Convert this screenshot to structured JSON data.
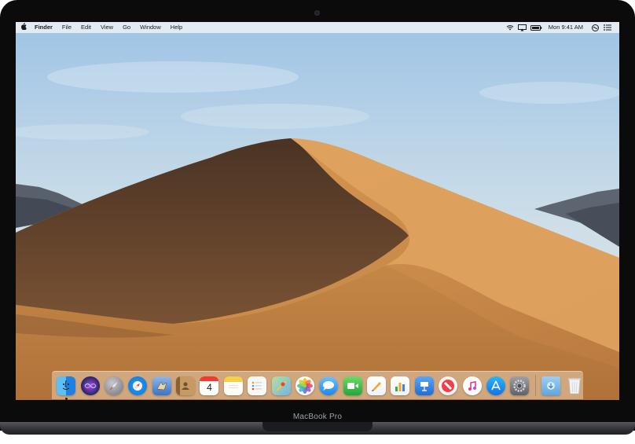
{
  "device": {
    "label": "MacBook Pro"
  },
  "menubar": {
    "apple_icon": "apple-logo",
    "app_name": "Finder",
    "menus": [
      "File",
      "Edit",
      "View",
      "Go",
      "Window",
      "Help"
    ],
    "clock": "Mon 9:41 AM",
    "status_icons": [
      "wifi-icon",
      "airplay-icon",
      "battery-icon",
      "siri-icon",
      "notification-center-icon"
    ]
  },
  "dock": {
    "apps": [
      {
        "name": "Finder",
        "color": "#2e9cf2",
        "running": true
      },
      {
        "name": "Siri",
        "color": "#3c2d78"
      },
      {
        "name": "Launchpad",
        "color": "#8c8f96"
      },
      {
        "name": "Safari",
        "color": "#1f8ff0"
      },
      {
        "name": "Mail",
        "color": "#5b8fd0"
      },
      {
        "name": "Contacts",
        "color": "#a2794a"
      },
      {
        "name": "Calendar",
        "color": "#ffffff",
        "badge_text": "4"
      },
      {
        "name": "Notes",
        "color": "#f7d55a"
      },
      {
        "name": "Reminders",
        "color": "#f4f4f4"
      },
      {
        "name": "Maps",
        "color": "#6fbf73"
      },
      {
        "name": "Photos",
        "color": "#ffffff"
      },
      {
        "name": "Messages",
        "color": "#3fa2f7"
      },
      {
        "name": "FaceTime",
        "color": "#3fc24c"
      },
      {
        "name": "Pages",
        "color": "#f5a623"
      },
      {
        "name": "Numbers",
        "color": "#2fb24a"
      },
      {
        "name": "Keynote",
        "color": "#2f7fe0"
      },
      {
        "name": "News",
        "color": "#f2f2f2"
      },
      {
        "name": "iTunes",
        "color": "#fdfdfd"
      },
      {
        "name": "App Store",
        "color": "#1f8ff0"
      },
      {
        "name": "System Preferences",
        "color": "#8a8d93"
      }
    ],
    "stack": [
      {
        "name": "Downloads",
        "color": "#7dbbe8"
      },
      {
        "name": "Trash",
        "color": "#e8e9eb"
      }
    ]
  }
}
